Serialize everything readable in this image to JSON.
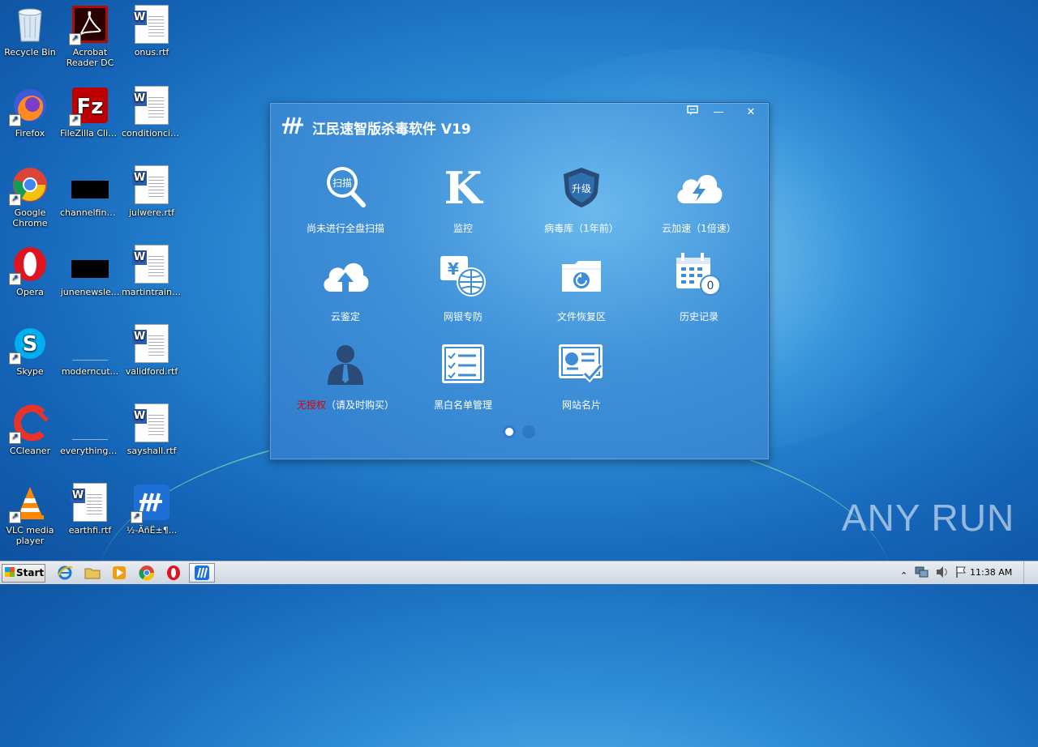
{
  "desktop": {
    "icons": [
      {
        "label": "Recycle Bin"
      },
      {
        "label": "Acrobat Reader DC"
      },
      {
        "label": "onus.rtf"
      },
      {
        "label": "Firefox"
      },
      {
        "label": "FileZilla Client"
      },
      {
        "label": "conditionciti..."
      },
      {
        "label": "Google Chrome"
      },
      {
        "label": "channelfinal..."
      },
      {
        "label": "julwere.rtf"
      },
      {
        "label": "Opera"
      },
      {
        "label": "junenewsle..."
      },
      {
        "label": "martintraini..."
      },
      {
        "label": "Skype"
      },
      {
        "label": "moderncut..."
      },
      {
        "label": "validford.rtf"
      },
      {
        "label": "CCleaner"
      },
      {
        "label": "everythingg..."
      },
      {
        "label": "sayshall.rtf"
      },
      {
        "label": "VLC media player"
      },
      {
        "label": "earthfi.rtf"
      },
      {
        "label": "½-ÃñË±¶..."
      }
    ]
  },
  "app": {
    "title": "江民速智版杀毒软件 V19",
    "tiles": [
      {
        "label": "尚未进行全盘扫描",
        "icon_text": "扫描"
      },
      {
        "label": "监控",
        "icon_text": "K"
      },
      {
        "label": "病毒库（1年前）",
        "icon_text": "升级"
      },
      {
        "label": "云加速（1倍速）"
      },
      {
        "label": "云鉴定"
      },
      {
        "label": "网银专防",
        "icon_text": "¥"
      },
      {
        "label": "文件恢复区"
      },
      {
        "label": "历史记录",
        "icon_text": "0"
      },
      {
        "label_red": "无授权",
        "label_rest": "（请及时购买）"
      },
      {
        "label": "黑白名单管理"
      },
      {
        "label": "网站名片"
      }
    ],
    "pages": {
      "count": 2,
      "active": 1
    }
  },
  "taskbar": {
    "start_label": "Start",
    "clock": "11:38 AM"
  },
  "watermark": "ANY RUN",
  "colors": {
    "accent_red": "#e00000",
    "window_blue": "#3f91d8"
  }
}
